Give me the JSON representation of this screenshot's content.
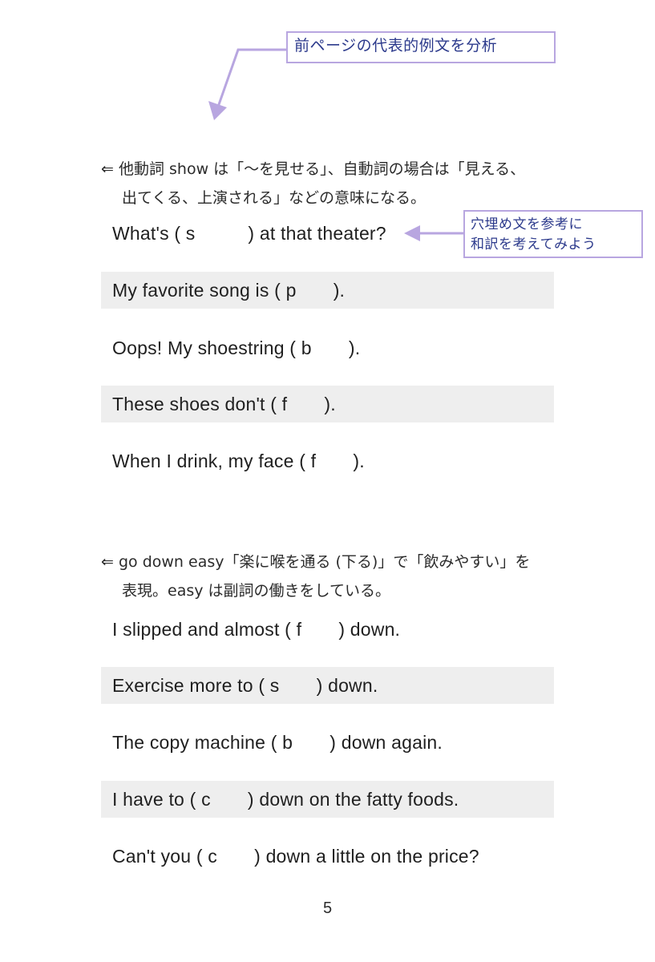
{
  "page": {
    "number": "5",
    "background_color": "#ffffff",
    "shaded_row_color": "#eeeeee",
    "accent_color": "#b8a6e0",
    "callout_text_color": "#2c3a8c",
    "body_text_color": "#2b2b2b"
  },
  "callouts": [
    {
      "id": "analyze",
      "text": "前ページの代表的例文を分析",
      "icon": "arrow-down-left-icon"
    },
    {
      "id": "translate",
      "text": "穴埋め文を参考に\n和訳を考えてみよう",
      "icon": "arrow-left-icon"
    }
  ],
  "notes": [
    {
      "id": "show",
      "lead": "⇐ ",
      "line1": "他動詞 show は「〜を見せる」、自動詞の場合は「見える、",
      "line2": "出てくる、上演される」などの意味になる。"
    },
    {
      "id": "godown",
      "lead": "⇐ ",
      "line1": "go down easy「楽に喉を通る (下る)」で「飲みやすい」を",
      "line2": "表現。easy は副詞の働きをしている。"
    }
  ],
  "sentences_group_1": [
    {
      "text": "What's ( s          ) at that theater?",
      "shaded": false
    },
    {
      "text": "My favorite song is ( p       ).",
      "shaded": true
    },
    {
      "text": "Oops! My shoestring ( b       ).",
      "shaded": false
    },
    {
      "text": "These shoes don't ( f       ).",
      "shaded": true
    },
    {
      "text": "When I drink, my face ( f       ).",
      "shaded": false
    }
  ],
  "sentences_group_2": [
    {
      "text": "I slipped and almost ( f       ) down.",
      "shaded": false
    },
    {
      "text": "Exercise more to ( s       ) down.",
      "shaded": true
    },
    {
      "text": "The copy machine ( b       ) down again.",
      "shaded": false
    },
    {
      "text": "I have to ( c       ) down on the fatty foods.",
      "shaded": true
    },
    {
      "text": "Can't you ( c       ) down a little on the price?",
      "shaded": false
    }
  ]
}
